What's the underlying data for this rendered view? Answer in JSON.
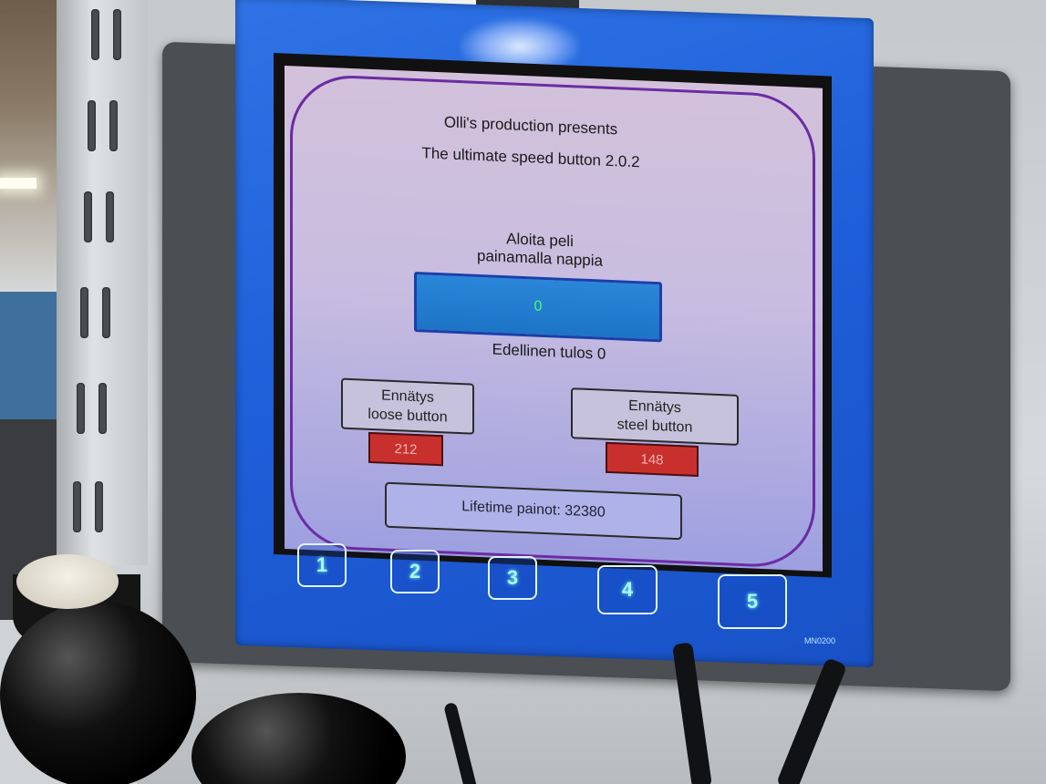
{
  "screen": {
    "line1": "Olli's production presents",
    "line2": "The ultimate speed button 2.0.2",
    "prompt_line1": "Aloita peli",
    "prompt_line2": "painamalla nappia",
    "counter_value": "0",
    "previous_result": "Edellinen tulos 0",
    "records": [
      {
        "label_line1": "Ennätys",
        "label_line2": "loose button",
        "value": "212"
      },
      {
        "label_line1": "Ennätys",
        "label_line2": "steel button",
        "value": "148"
      }
    ],
    "lifetime": "Lifetime painot: 32380"
  },
  "hardware_buttons": [
    "1",
    "2",
    "3",
    "4",
    "5"
  ],
  "model_label": "MN0200",
  "colors": {
    "bezel": "#1e5ed8",
    "screen_bg": "#c8bde0",
    "counter_bg": "#1d74c7",
    "counter_text": "#49ff6a",
    "record_value_bg": "#c8302e"
  }
}
